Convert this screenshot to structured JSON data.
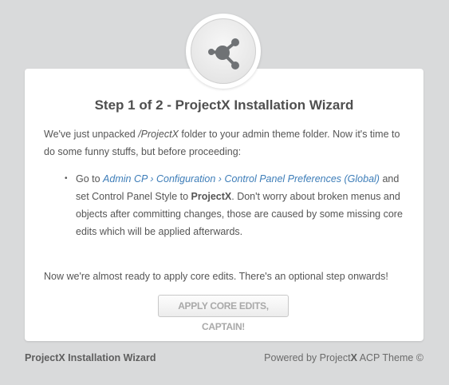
{
  "logo": {
    "icon": "share-network-icon",
    "color": "#6f7275"
  },
  "wizard": {
    "title": "Step 1 of 2 - ProjectX Installation Wizard",
    "intro_part1": "We've just unpacked ",
    "intro_folder": "/ProjectX",
    "intro_part2": " folder to your admin theme folder. Now it's time to do some funny stuffs, but before proceeding:",
    "step1": {
      "bullet": "•",
      "prefix": "Go to ",
      "link_admin_cp": "Admin CP",
      "separator": " › ",
      "link_configuration": "Configuration",
      "link_cp_preferences": "Control Panel Preferences (Global)",
      "middle": " and set Control Panel Style to ",
      "style_name": "ProjectX",
      "suffix": ". Don't worry about broken menus and objects after committing changes, those are caused by some missing core edits which will be applied afterwards."
    },
    "outro": "Now we're almost ready to apply core edits. There's an optional step onwards!",
    "apply_button": "APPLY CORE EDITS, CAPTAIN!"
  },
  "footer": {
    "left": "ProjectX Installation Wizard",
    "right_prefix": "Powered by Project",
    "right_bold": "X",
    "right_suffix": " ACP Theme ©"
  },
  "colors": {
    "link": "#3d7db8",
    "background": "#d9dadb",
    "card": "#ffffff"
  }
}
